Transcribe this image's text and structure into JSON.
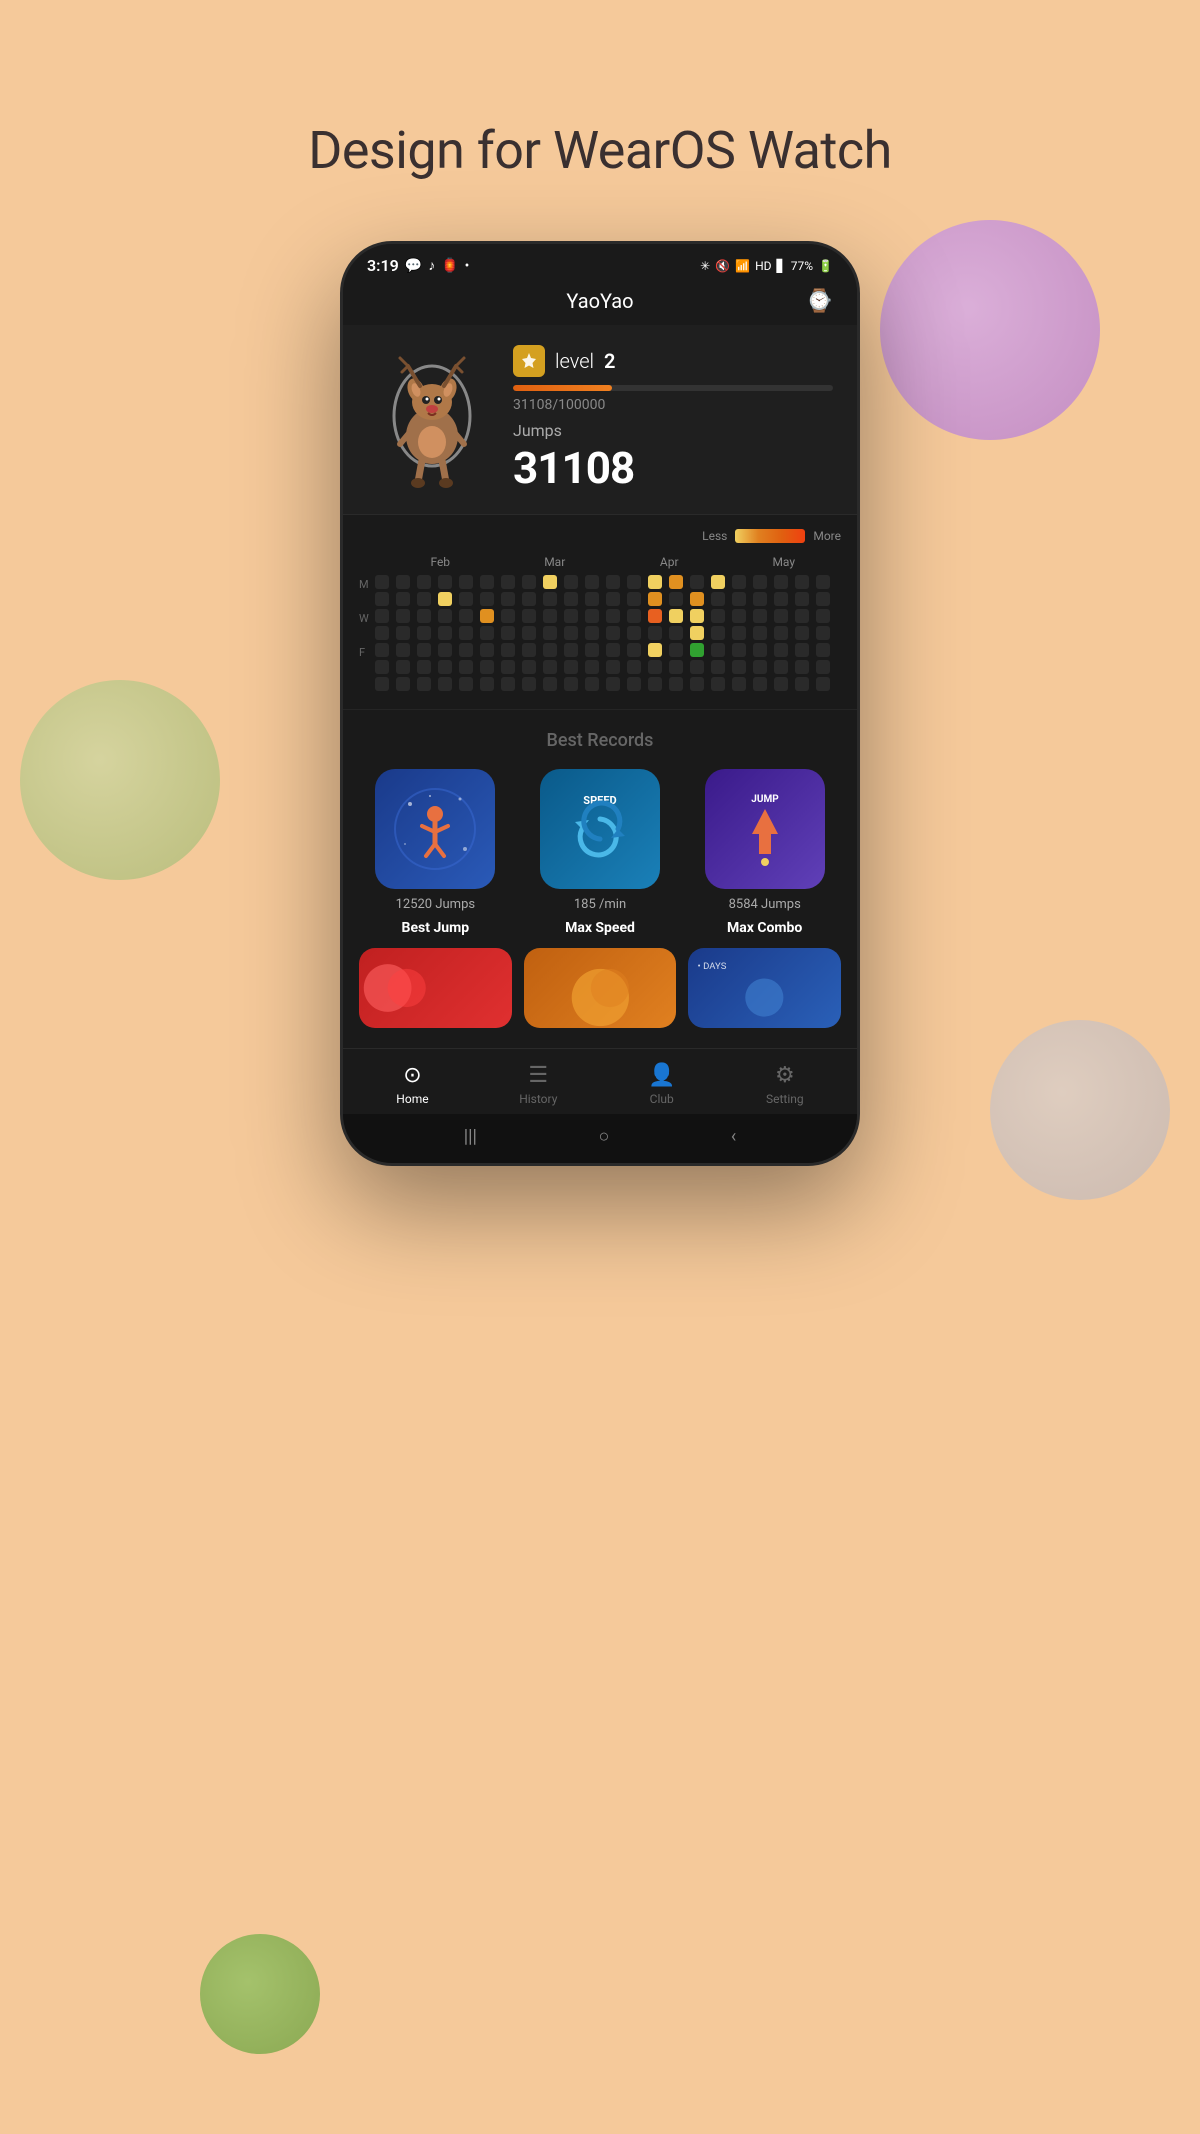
{
  "page": {
    "title": "Design for WearOS Watch"
  },
  "status_bar": {
    "time": "3:19",
    "battery": "77%",
    "icons": [
      "wechat",
      "music",
      "notification",
      "bluetooth",
      "mute",
      "wifi",
      "hd",
      "signal"
    ]
  },
  "app_header": {
    "title": "YaoYao",
    "watch_icon": "⌚"
  },
  "profile": {
    "level_label": "level",
    "level_num": "2",
    "progress_text": "31108/100000",
    "jumps_label": "Jumps",
    "jumps_count": "31108",
    "progress_pct": 31
  },
  "calendar": {
    "legend_less": "Less",
    "legend_more": "More",
    "months": [
      "Feb",
      "Mar",
      "Apr",
      "May"
    ],
    "day_labels": [
      "M",
      "",
      "W",
      "",
      "F",
      "",
      ""
    ]
  },
  "best_records": {
    "section_title": "Best Records",
    "records": [
      {
        "sub": "12520 Jumps",
        "name": "Best Jump"
      },
      {
        "sub": "185 /min",
        "name": "Max Speed"
      },
      {
        "sub": "8584 Jumps",
        "name": "Max Combo"
      }
    ]
  },
  "nav": {
    "items": [
      {
        "label": "Home",
        "active": true
      },
      {
        "label": "History",
        "active": false
      },
      {
        "label": "Club",
        "active": false
      },
      {
        "label": "Setting",
        "active": false
      }
    ]
  },
  "android_nav": {
    "back": "‹",
    "home": "○",
    "recent": "|||"
  }
}
